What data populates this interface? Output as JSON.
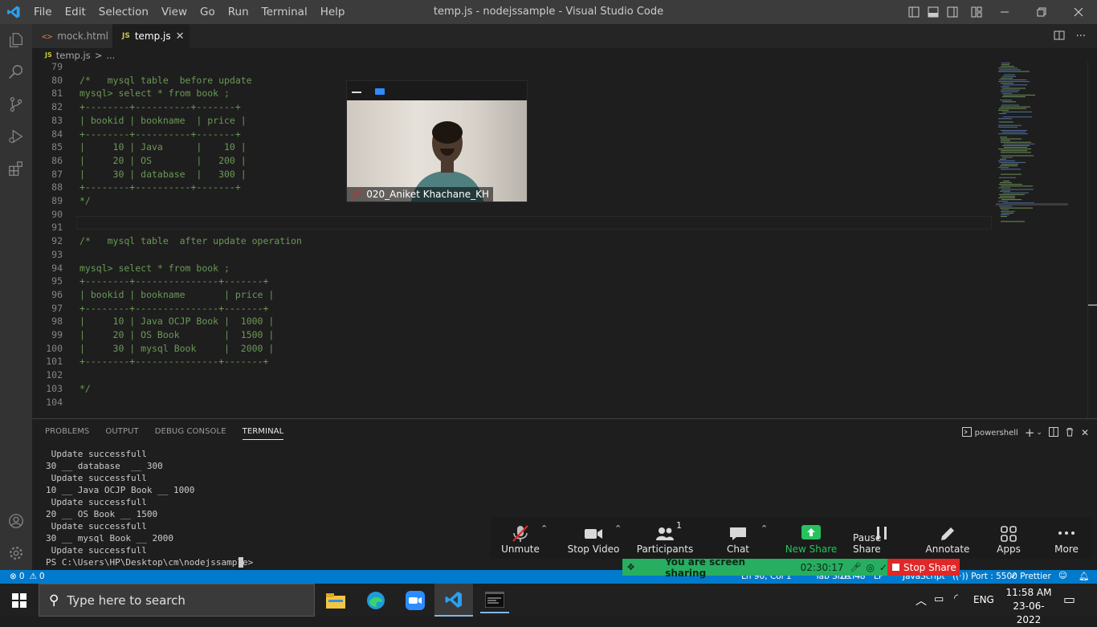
{
  "window": {
    "title": "temp.js - nodejssample - Visual Studio Code",
    "menu": [
      "File",
      "Edit",
      "Selection",
      "View",
      "Go",
      "Run",
      "Terminal",
      "Help"
    ]
  },
  "tabs": [
    {
      "label": "mock.html",
      "icon": "html-file-icon",
      "active": false
    },
    {
      "label": "temp.js",
      "icon": "js-file-icon",
      "active": true
    }
  ],
  "breadcrumb": {
    "file_badge": "JS",
    "file": "temp.js",
    "sep": ">",
    "tail": "..."
  },
  "editor": {
    "lines": [
      {
        "n": "79",
        "t": ""
      },
      {
        "n": "80",
        "t": "/*   mysql table  before update"
      },
      {
        "n": "81",
        "t": "mysql> select * from book ;"
      },
      {
        "n": "82",
        "t": "+--------+----------+-------+"
      },
      {
        "n": "83",
        "t": "| bookid | bookname  | price |"
      },
      {
        "n": "84",
        "t": "+--------+----------+-------+"
      },
      {
        "n": "85",
        "t": "|     10 | Java      |    10 |"
      },
      {
        "n": "86",
        "t": "|     20 | OS        |   200 |"
      },
      {
        "n": "87",
        "t": "|     30 | database  |   300 |"
      },
      {
        "n": "88",
        "t": "+--------+----------+-------+"
      },
      {
        "n": "89",
        "t": "*/"
      },
      {
        "n": "90",
        "t": ""
      },
      {
        "n": "91",
        "t": ""
      },
      {
        "n": "92",
        "t": "/*   mysql table  after update operation"
      },
      {
        "n": "93",
        "t": ""
      },
      {
        "n": "94",
        "t": "mysql> select * from book ;"
      },
      {
        "n": "95",
        "t": "+--------+---------------+-------+"
      },
      {
        "n": "96",
        "t": "| bookid | bookname       | price |"
      },
      {
        "n": "97",
        "t": "+--------+---------------+-------+"
      },
      {
        "n": "98",
        "t": "|     10 | Java OCJP Book |  1000 |"
      },
      {
        "n": "99",
        "t": "|     20 | OS Book        |  1500 |"
      },
      {
        "n": "100",
        "t": "|     30 | mysql Book     |  2000 |"
      },
      {
        "n": "101",
        "t": "+--------+---------------+-------+"
      },
      {
        "n": "102",
        "t": ""
      },
      {
        "n": "103",
        "t": "*/"
      },
      {
        "n": "104",
        "t": ""
      }
    ]
  },
  "panel": {
    "tabs": [
      "PROBLEMS",
      "OUTPUT",
      "DEBUG CONSOLE",
      "TERMINAL"
    ],
    "shell": "powershell",
    "terminal_lines": [
      " Update successfull",
      "30 __ database  __ 300",
      " Update successfull",
      "10 __ Java OCJP Book __ 1000",
      " Update successfull",
      "20 __ OS Book __ 1500",
      " Update successfull",
      "30 __ mysql Book __ 2000",
      " Update successfull",
      "PS C:\\Users\\HP\\Desktop\\cm\\nodejssample> "
    ]
  },
  "statusbar": {
    "errors": "0",
    "warnings": "0",
    "position": "Ln 90, Col 1",
    "tab_size": "Tab Size: 4",
    "encoding": "UTF-8",
    "eol": "LF",
    "language": "JavaScript",
    "port": "Port : 5500",
    "prettier": "Prettier"
  },
  "zoom": {
    "participant_name": "020_Aniket Khachane_KH",
    "buttons": {
      "unmute": "Unmute",
      "stop_video": "Stop Video",
      "participants": "Participants",
      "participants_count": "1",
      "chat": "Chat",
      "new_share": "New Share",
      "pause_share": "Pause Share",
      "annotate": "Annotate",
      "apps": "Apps",
      "more": "More"
    },
    "sharing_text": "You are screen sharing",
    "timer": "02:30:17",
    "stop_share": "Stop Share"
  },
  "taskbar": {
    "search_placeholder": "Type here to search",
    "language": "ENG",
    "time": "11:58 AM",
    "date": "23-06-2022"
  },
  "colors": {
    "accent": "#007acc",
    "comment": "#6a9955",
    "share_green": "#27ae60",
    "stop_red": "#e02828"
  }
}
